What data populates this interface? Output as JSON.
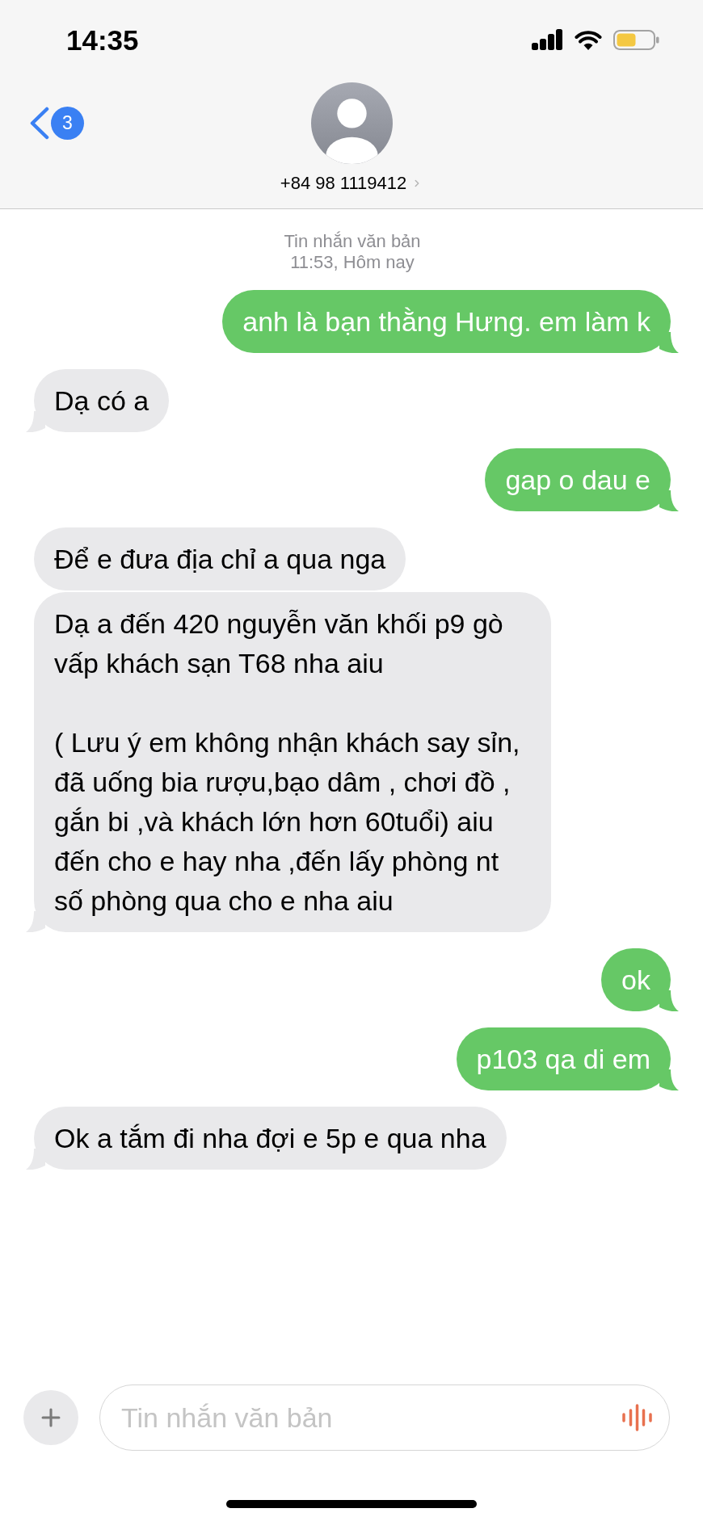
{
  "status_bar": {
    "time": "14:35"
  },
  "header": {
    "back_badge": "3",
    "contact": "+84 98 1119412"
  },
  "conversation": {
    "label": "Tin nhắn văn bản",
    "timestamp": "11:53, Hôm nay"
  },
  "messages": [
    {
      "kind": "sent",
      "text": "anh là bạn thằng Hưng. em làm k",
      "tail": true
    },
    {
      "kind": "received",
      "text": "Dạ có a",
      "tail": true
    },
    {
      "kind": "sent",
      "text": "gap o dau e",
      "tail": true
    },
    {
      "kind": "received",
      "text": "Để e đưa địa chỉ a qua nga",
      "tail": false
    },
    {
      "kind": "received",
      "text": "Dạ a đến 420 nguyễn văn khối p9 gò vấp khách sạn T68 nha aiu\n\n( Lưu ý em không nhận khách say sỉn, đã uống bia rượu,bạo dâm , chơi đồ , gắn bi ,và khách lớn hơn 60tuổi) aiu đến cho e hay nha ,đến lấy phòng nt số phòng qua cho e nha aiu",
      "tail": true
    },
    {
      "kind": "sent",
      "text": "ok",
      "tail": true
    },
    {
      "kind": "sent",
      "text": "p103 qa di em",
      "tail": true
    },
    {
      "kind": "received",
      "text": "Ok a tắm đi nha đợi e 5p e qua nha",
      "tail": true
    }
  ],
  "composer": {
    "placeholder": "Tin nhắn văn bản"
  }
}
